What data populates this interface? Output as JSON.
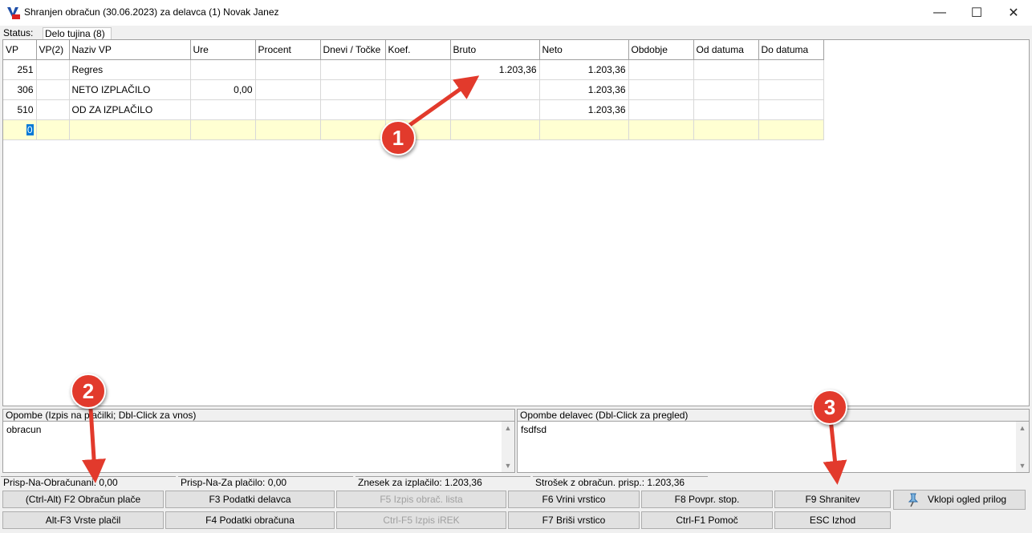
{
  "window": {
    "title": "Shranjen obračun (30.06.2023) za delavca (1) Novak Janez",
    "minimize": "—",
    "maximize": "☐",
    "close": "✕"
  },
  "status": {
    "label": "Status:",
    "value": "Delo tujina (8)"
  },
  "grid": {
    "columns": [
      "VP",
      "VP(2)",
      "Naziv VP",
      "Ure",
      "Procent",
      "Dnevi / Točke",
      "Koef.",
      "Bruto",
      "Neto",
      "Obdobje",
      "Od datuma",
      "Do datuma"
    ],
    "rows": [
      {
        "vp": "251",
        "vp2": "",
        "naziv": "Regres",
        "ure": "",
        "procent": "",
        "dnevi": "",
        "koef": "",
        "bruto": "1.203,36",
        "neto": "1.203,36",
        "obdobje": "",
        "od": "",
        "do": ""
      },
      {
        "vp": "306",
        "vp2": "",
        "naziv": "NETO IZPLAČILO",
        "ure": "0,00",
        "procent": "",
        "dnevi": "",
        "koef": "",
        "bruto": "",
        "neto": "1.203,36",
        "obdobje": "",
        "od": "",
        "do": ""
      },
      {
        "vp": "510",
        "vp2": "",
        "naziv": "OD ZA IZPLAČILO",
        "ure": "",
        "procent": "",
        "dnevi": "",
        "koef": "",
        "bruto": "",
        "neto": "1.203,36",
        "obdobje": "",
        "od": "",
        "do": ""
      }
    ],
    "new_row_vp": "0"
  },
  "notes": {
    "left_header": "Opombe (Izpis na plačilki; Dbl-Click za vnos)",
    "left_text": "obracun",
    "right_header": "Opombe delavec (Dbl-Click za pregled)",
    "right_text": "fsdfsd"
  },
  "totals": {
    "prisp_obracunani": "Prisp-Na-Obračunani: 0,00",
    "prisp_za_placilo": "Prisp-Na-Za plačilo: 0,00",
    "znesek": "Znesek za izplačilo: 1.203,36",
    "strosek": "Strošek z obračun. prisp.: 1.203,36"
  },
  "buttons": {
    "obracun_place": "(Ctrl-Alt) F2  Obračun plače",
    "podatki_delavca": "F3 Podatki delavca",
    "izpis_obrac_lista": "F5 Izpis obrač. lista",
    "vrini_vrstico": "F6 Vrini vrstico",
    "povpr_stop": "F8  Povpr. stop.",
    "shranitev": "F9  Shranitev",
    "vklopi_ogled": "Vklopi ogled prilog",
    "vrste_placil": "Alt-F3 Vrste plačil",
    "podatki_obracuna": "F4  Podatki obračuna",
    "izpis_irek": "Ctrl-F5  Izpis iREK",
    "brisi_vrstico": "F7 Briši vrstico",
    "pomoc": "Ctrl-F1  Pomoč",
    "izhod": "ESC  Izhod"
  },
  "annotations": {
    "badge1": "1",
    "badge2": "2",
    "badge3": "3"
  },
  "colors": {
    "accent_badge": "#e23a2c",
    "new_row": "#ffffd2",
    "selection": "#0078d7"
  }
}
